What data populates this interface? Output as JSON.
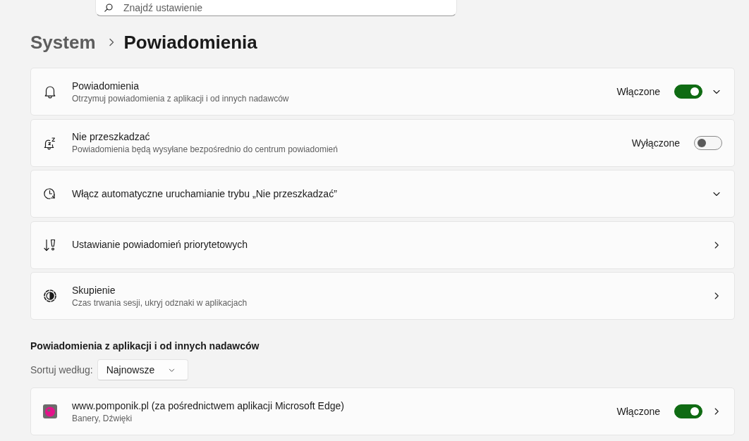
{
  "search": {
    "placeholder": "Znajdź ustawienie"
  },
  "breadcrumb": {
    "parent": "System",
    "current": "Powiadomienia"
  },
  "settings": [
    {
      "kind": "expander",
      "title": "Powiadomienia",
      "subtitle": "Otrzymuj powiadomienia z aplikacji i od innych nadawców",
      "toggle": {
        "label": "Włączone",
        "on": true
      },
      "expanded": false
    },
    {
      "kind": "plain",
      "title": "Nie przeszkadzać",
      "subtitle": "Powiadomienia będą wysyłane bezpośrednio do centrum powiadomień",
      "toggle": {
        "label": "Wyłączone",
        "on": false
      }
    },
    {
      "kind": "expander",
      "title": "Włącz automatyczne uruchamianie trybu „Nie przeszkadzać”",
      "expanded": false
    },
    {
      "kind": "link",
      "title": "Ustawianie powiadomień priorytetowych"
    },
    {
      "kind": "link",
      "title": "Skupienie",
      "subtitle": "Czas trwania sesji, ukryj odznaki w aplikacjach"
    }
  ],
  "apps": {
    "heading": "Powiadomienia z aplikacji i od innych nadawców",
    "sort": {
      "label": "Sortuj według:",
      "value": "Najnowsze"
    },
    "items": [
      {
        "kind": "link",
        "title": "www.pomponik.pl (za pośrednictwem aplikacji Microsoft Edge)",
        "subtitle": "Banery, Dźwięki",
        "toggle": {
          "label": "Włączone",
          "on": true
        }
      }
    ]
  }
}
